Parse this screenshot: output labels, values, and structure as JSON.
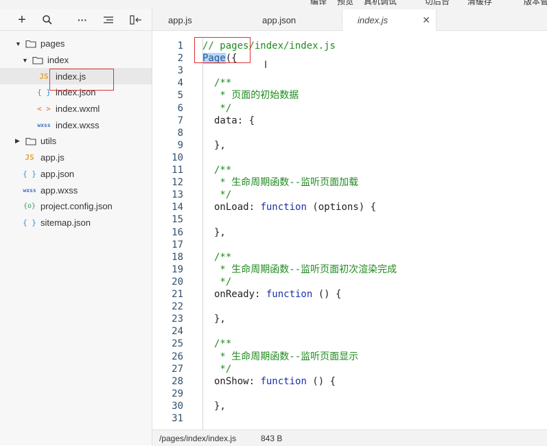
{
  "top_strip": {
    "items": [
      "编译",
      "预览",
      "真机调试",
      "切后台",
      "清缓存",
      "版本管"
    ]
  },
  "sidebar": {
    "toolbar": {
      "add": "+",
      "search": "⌕",
      "more": "···",
      "collapse": "≡",
      "layout": "▯⇤"
    },
    "tree": [
      {
        "label": "pages",
        "type": "folder",
        "expanded": true,
        "depth": 0
      },
      {
        "label": "index",
        "type": "folder",
        "expanded": true,
        "depth": 1
      },
      {
        "label": "index.js",
        "type": "js",
        "depth": 2,
        "selected": true,
        "icon": "JS"
      },
      {
        "label": "index.json",
        "type": "json",
        "depth": 2,
        "icon": "{ }"
      },
      {
        "label": "index.wxml",
        "type": "wxml",
        "depth": 2,
        "icon": "< >"
      },
      {
        "label": "index.wxss",
        "type": "wxss",
        "depth": 2,
        "icon": "wxss"
      },
      {
        "label": "utils",
        "type": "folder",
        "expanded": false,
        "depth": 0
      },
      {
        "label": "app.js",
        "type": "js",
        "depth": 0,
        "icon": "JS"
      },
      {
        "label": "app.json",
        "type": "json",
        "depth": 0,
        "icon": "{ }"
      },
      {
        "label": "app.wxss",
        "type": "wxss",
        "depth": 0,
        "icon": "wxss"
      },
      {
        "label": "project.config.json",
        "type": "config",
        "depth": 0,
        "icon": "{o}"
      },
      {
        "label": "sitemap.json",
        "type": "json",
        "depth": 0,
        "icon": "{ }"
      }
    ]
  },
  "editor": {
    "tabs": [
      {
        "label": "app.js",
        "active": false
      },
      {
        "label": "app.json",
        "active": false
      },
      {
        "label": "index.js",
        "active": true,
        "close": "✕"
      }
    ],
    "lines": [
      {
        "n": "1",
        "segs": [
          {
            "t": "// pages/index/index.js",
            "c": "comment"
          }
        ],
        "indent": 0
      },
      {
        "n": "2",
        "segs": [
          {
            "t": "Page",
            "c": "sel"
          },
          {
            "t": "({",
            "c": ""
          }
        ],
        "indent": 0
      },
      {
        "n": "3",
        "segs": [],
        "indent": 1
      },
      {
        "n": "4",
        "segs": [
          {
            "t": "/**",
            "c": "comment"
          }
        ],
        "indent": 1
      },
      {
        "n": "5",
        "segs": [
          {
            "t": " * 页面的初始数据",
            "c": "comment"
          }
        ],
        "indent": 1
      },
      {
        "n": "6",
        "segs": [
          {
            "t": " */",
            "c": "comment"
          }
        ],
        "indent": 1
      },
      {
        "n": "7",
        "segs": [
          {
            "t": "data: {",
            "c": ""
          }
        ],
        "indent": 1
      },
      {
        "n": "8",
        "segs": [],
        "indent": 1
      },
      {
        "n": "9",
        "segs": [
          {
            "t": "},",
            "c": ""
          }
        ],
        "indent": 1
      },
      {
        "n": "10",
        "segs": [],
        "indent": 1
      },
      {
        "n": "11",
        "segs": [
          {
            "t": "/**",
            "c": "comment"
          }
        ],
        "indent": 1
      },
      {
        "n": "12",
        "segs": [
          {
            "t": " * 生命周期函数--监听页面加载",
            "c": "comment"
          }
        ],
        "indent": 1
      },
      {
        "n": "13",
        "segs": [
          {
            "t": " */",
            "c": "comment"
          }
        ],
        "indent": 1
      },
      {
        "n": "14",
        "segs": [
          {
            "t": "onLoad: ",
            "c": ""
          },
          {
            "t": "function",
            "c": "kw"
          },
          {
            "t": " (options) {",
            "c": ""
          }
        ],
        "indent": 1
      },
      {
        "n": "15",
        "segs": [],
        "indent": 1
      },
      {
        "n": "16",
        "segs": [
          {
            "t": "},",
            "c": ""
          }
        ],
        "indent": 1
      },
      {
        "n": "17",
        "segs": [],
        "indent": 1
      },
      {
        "n": "18",
        "segs": [
          {
            "t": "/**",
            "c": "comment"
          }
        ],
        "indent": 1
      },
      {
        "n": "19",
        "segs": [
          {
            "t": " * 生命周期函数--监听页面初次渲染完成",
            "c": "comment"
          }
        ],
        "indent": 1
      },
      {
        "n": "20",
        "segs": [
          {
            "t": " */",
            "c": "comment"
          }
        ],
        "indent": 1
      },
      {
        "n": "21",
        "segs": [
          {
            "t": "onReady: ",
            "c": ""
          },
          {
            "t": "function",
            "c": "kw"
          },
          {
            "t": " () {",
            "c": ""
          }
        ],
        "indent": 1
      },
      {
        "n": "22",
        "segs": [],
        "indent": 1
      },
      {
        "n": "23",
        "segs": [
          {
            "t": "},",
            "c": ""
          }
        ],
        "indent": 1
      },
      {
        "n": "24",
        "segs": [],
        "indent": 1
      },
      {
        "n": "25",
        "segs": [
          {
            "t": "/**",
            "c": "comment"
          }
        ],
        "indent": 1
      },
      {
        "n": "26",
        "segs": [
          {
            "t": " * 生命周期函数--监听页面显示",
            "c": "comment"
          }
        ],
        "indent": 1
      },
      {
        "n": "27",
        "segs": [
          {
            "t": " */",
            "c": "comment"
          }
        ],
        "indent": 1
      },
      {
        "n": "28",
        "segs": [
          {
            "t": "onShow: ",
            "c": ""
          },
          {
            "t": "function",
            "c": "kw"
          },
          {
            "t": " () {",
            "c": ""
          }
        ],
        "indent": 1
      },
      {
        "n": "29",
        "segs": [],
        "indent": 1
      },
      {
        "n": "30",
        "segs": [
          {
            "t": "},",
            "c": ""
          }
        ],
        "indent": 1
      },
      {
        "n": "31",
        "segs": [],
        "indent": 1
      }
    ]
  },
  "status_bar": {
    "path": "/pages/index/index.js",
    "size": "843 B"
  },
  "colors": {
    "comment": "#1f8a1f",
    "keyword": "#1b2fa8",
    "selection": "#b8d6f7",
    "annotation_box": "#e03030",
    "line_number": "#2f4f6f"
  }
}
